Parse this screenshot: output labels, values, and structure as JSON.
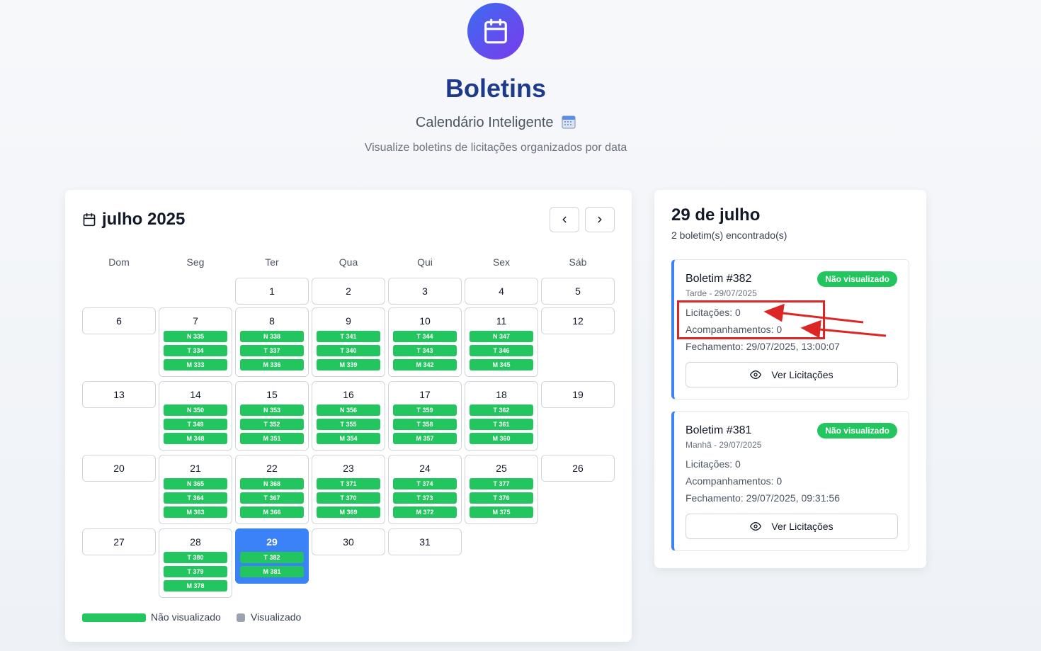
{
  "header": {
    "title": "Boletins",
    "subtitle": "Calendário Inteligente",
    "description": "Visualize boletins de licitações organizados por data",
    "logo_icon": "calendar-icon"
  },
  "calendar": {
    "month_title": "julho 2025",
    "prev_icon": "chevron-left-icon",
    "next_icon": "chevron-right-icon",
    "weekdays": [
      "Dom",
      "Seg",
      "Ter",
      "Qua",
      "Qui",
      "Sex",
      "Sáb"
    ],
    "days": [
      {
        "day": "1",
        "badges": []
      },
      {
        "day": "2",
        "badges": []
      },
      {
        "day": "3",
        "badges": []
      },
      {
        "day": "4",
        "badges": []
      },
      {
        "day": "5",
        "badges": []
      },
      {
        "day": "6",
        "badges": []
      },
      {
        "day": "7",
        "badges": [
          "N 335",
          "T 334",
          "M 333"
        ]
      },
      {
        "day": "8",
        "badges": [
          "N 338",
          "T 337",
          "M 336"
        ]
      },
      {
        "day": "9",
        "badges": [
          "T 341",
          "T 340",
          "M 339"
        ]
      },
      {
        "day": "10",
        "badges": [
          "T 344",
          "T 343",
          "M 342"
        ]
      },
      {
        "day": "11",
        "badges": [
          "N 347",
          "T 346",
          "M 345"
        ]
      },
      {
        "day": "12",
        "badges": []
      },
      {
        "day": "13",
        "badges": []
      },
      {
        "day": "14",
        "badges": [
          "N 350",
          "T 349",
          "M 348"
        ]
      },
      {
        "day": "15",
        "badges": [
          "N 353",
          "T 352",
          "M 351"
        ]
      },
      {
        "day": "16",
        "badges": [
          "N 356",
          "T 355",
          "M 354"
        ]
      },
      {
        "day": "17",
        "badges": [
          "T 359",
          "T 358",
          "M 357"
        ]
      },
      {
        "day": "18",
        "badges": [
          "T 362",
          "T 361",
          "M 360"
        ]
      },
      {
        "day": "19",
        "badges": []
      },
      {
        "day": "20",
        "badges": []
      },
      {
        "day": "21",
        "badges": [
          "N 365",
          "T 364",
          "M 363"
        ]
      },
      {
        "day": "22",
        "badges": [
          "N 368",
          "T 367",
          "M 366"
        ]
      },
      {
        "day": "23",
        "badges": [
          "T 371",
          "T 370",
          "M 369"
        ]
      },
      {
        "day": "24",
        "badges": [
          "T 374",
          "T 373",
          "M 372"
        ]
      },
      {
        "day": "25",
        "badges": [
          "T 377",
          "T 376",
          "M 375"
        ]
      },
      {
        "day": "26",
        "badges": []
      },
      {
        "day": "27",
        "badges": []
      },
      {
        "day": "28",
        "badges": [
          "T 380",
          "T 379",
          "M 378"
        ]
      },
      {
        "day": "29",
        "badges": [
          "T 382",
          "M 381"
        ],
        "selected": true
      },
      {
        "day": "30",
        "badges": []
      },
      {
        "day": "31",
        "badges": []
      }
    ],
    "legend": {
      "unviewed_label": "Não visualizado",
      "viewed_label": "Visualizado"
    }
  },
  "detail": {
    "date_title": "29 de julho",
    "count_text": "2 boletim(s) encontrado(s)",
    "bulletins": [
      {
        "title": "Boletim #382",
        "status": "Não visualizado",
        "meta": "Tarde - 29/07/2025",
        "licitacoes": "Licitações: 0",
        "acompanhamentos": "Acompanhamentos: 0",
        "fechamento": "Fechamento: 29/07/2025, 13:00:07",
        "button_label": "Ver Licitações"
      },
      {
        "title": "Boletim #381",
        "status": "Não visualizado",
        "meta": "Manhã - 29/07/2025",
        "licitacoes": "Licitações: 0",
        "acompanhamentos": "Acompanhamentos: 0",
        "fechamento": "Fechamento: 29/07/2025, 09:31:56",
        "button_label": "Ver Licitações"
      }
    ]
  },
  "colors": {
    "accent": "#3b82f6",
    "badge_green": "#22c55e",
    "title_blue": "#1e3a8a",
    "annotation_red": "#dc2626"
  }
}
